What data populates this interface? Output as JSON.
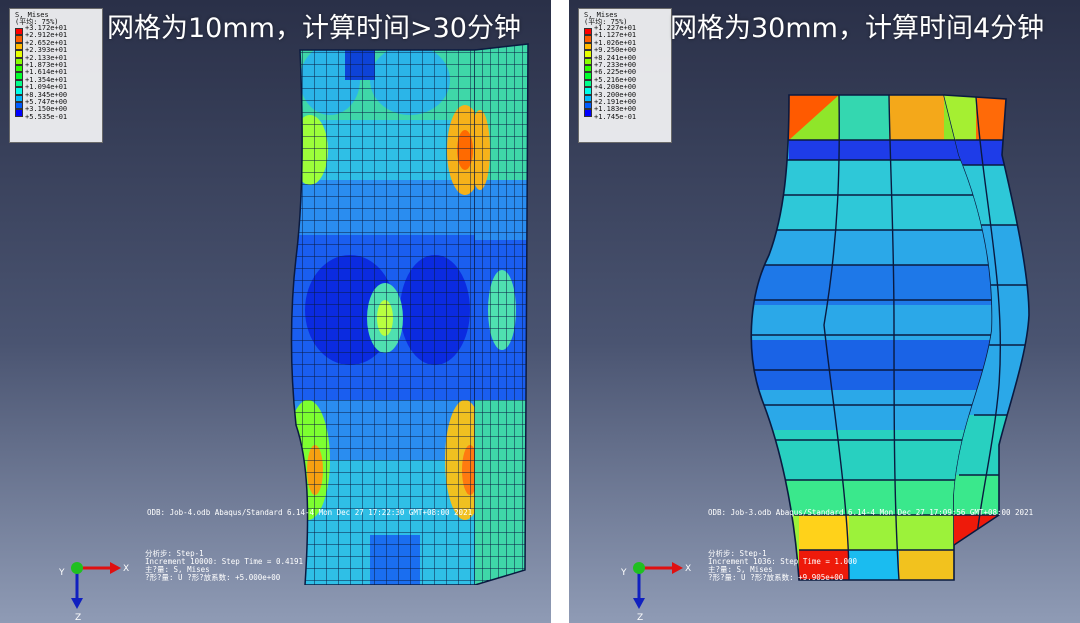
{
  "left": {
    "title": "网格为10mm，计算时间>30分钟",
    "legend": {
      "title": "S, Mises",
      "subtitle": "(平均: 75%)",
      "colors": [
        "#ff0000",
        "#ff5d00",
        "#ffba00",
        "#e7ff00",
        "#8aff00",
        "#2dff00",
        "#00ff2e",
        "#00ff8b",
        "#00ffe8",
        "#00b9ff",
        "#005cff",
        "#0000ff"
      ],
      "values": [
        "+3.172e+01",
        "+2.912e+01",
        "+2.652e+01",
        "+2.393e+01",
        "+2.133e+01",
        "+1.873e+01",
        "+1.614e+01",
        "+1.354e+01",
        "+1.094e+01",
        "+8.345e+00",
        "+5.747e+00",
        "+3.150e+00",
        "+5.535e-01"
      ]
    },
    "odb_line": "ODB: Job-4.odb    Abaqus/Standard 6.14-4    Mon Dec 27 17:22:30 GMT+08:00 2021",
    "step_lines": [
      "分析步: Step-1",
      "Increment  10000: Step Time =   0.4191",
      "主?量: S, Mises",
      "?形?量: U   ?形?放系数: +5.000e+00"
    ],
    "triad": {
      "x": "X",
      "y": "Y",
      "z": "Z"
    }
  },
  "right": {
    "title": "网格为30mm，计算时间4分钟",
    "legend": {
      "title": "S, Mises",
      "subtitle": "(平均: 75%)",
      "colors": [
        "#ff0000",
        "#ff5d00",
        "#ffba00",
        "#e7ff00",
        "#8aff00",
        "#2dff00",
        "#00ff2e",
        "#00ff8b",
        "#00ffe8",
        "#00b9ff",
        "#005cff",
        "#0000ff"
      ],
      "values": [
        "+1.227e+01",
        "+1.127e+01",
        "+1.026e+01",
        "+9.250e+00",
        "+8.241e+00",
        "+7.233e+00",
        "+6.225e+00",
        "+5.216e+00",
        "+4.208e+00",
        "+3.200e+00",
        "+2.191e+00",
        "+1.183e+00",
        "+1.745e-01"
      ]
    },
    "odb_line": "ODB: Job-3.odb    Abaqus/Standard 6.14-4    Mon Dec 27 17:09:56 GMT+08:00 2021",
    "step_lines": [
      "分析步: Step-1",
      "Increment   1036: Step Time =   1.000",
      "主?量: S, Mises",
      "?形?量: U   ?形?放系数: +9.905e+00"
    ],
    "triad": {
      "x": "X",
      "y": "Y",
      "z": "Z"
    }
  }
}
